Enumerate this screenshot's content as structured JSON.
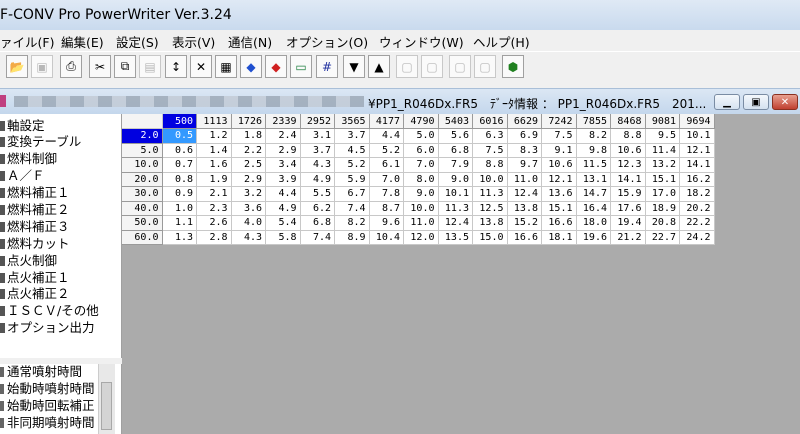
{
  "app": {
    "title": "F-CONV Pro PowerWriter Ver.3.24"
  },
  "menu": [
    "ァイル(F)",
    "編集(E)",
    "設定(S)",
    "表示(V)",
    "通信(N)",
    "オプション(O)",
    "ウィンドウ(W)",
    "ヘルプ(H)"
  ],
  "toolbar": {
    "icons": [
      "open-folder-icon",
      "save-icon",
      "print-icon",
      "cut-icon",
      "copy-icon",
      "paste-icon",
      "font-up-icon",
      "font-clear-icon",
      "stamp-icon",
      "car-blue-icon",
      "car-red-icon",
      "monitor-icon",
      "grid-icon",
      "write-icon",
      "read-icon",
      "disabled-icon-1",
      "disabled-icon-2",
      "disabled-icon-3",
      "disabled-icon-4",
      "shield-icon"
    ]
  },
  "doc": {
    "title": "¥PP1_R046Dx.FR5　ﾃﾞｰﾀ情報 ： PP1_R046Dx.FR5　201..."
  },
  "tree": [
    "軸設定",
    "変換テーブル",
    "燃料制御",
    "Ａ／Ｆ",
    "燃料補正１",
    "燃料補正２",
    "燃料補正３",
    "燃料カット",
    "点火制御",
    "点火補正１",
    "点火補正２",
    "ＩＳＣＶ/その他",
    "オプション出力"
  ],
  "list": [
    "通常噴射時間",
    "始動時噴射時間",
    "始動時回転補正",
    "非同期噴射時間"
  ],
  "table": {
    "cols": [
      "500",
      "1113",
      "1726",
      "2339",
      "2952",
      "3565",
      "4177",
      "4790",
      "5403",
      "6016",
      "6629",
      "7242",
      "7855",
      "8468",
      "9081",
      "9694"
    ],
    "rows": [
      {
        "h": "2.0",
        "v": [
          "0.5",
          "1.2",
          "1.8",
          "2.4",
          "3.1",
          "3.7",
          "4.4",
          "5.0",
          "5.6",
          "6.3",
          "6.9",
          "7.5",
          "8.2",
          "8.8",
          "9.5",
          "10.1"
        ]
      },
      {
        "h": "5.0",
        "v": [
          "0.6",
          "1.4",
          "2.2",
          "2.9",
          "3.7",
          "4.5",
          "5.2",
          "6.0",
          "6.8",
          "7.5",
          "8.3",
          "9.1",
          "9.8",
          "10.6",
          "11.4",
          "12.1"
        ]
      },
      {
        "h": "10.0",
        "v": [
          "0.7",
          "1.6",
          "2.5",
          "3.4",
          "4.3",
          "5.2",
          "6.1",
          "7.0",
          "7.9",
          "8.8",
          "9.7",
          "10.6",
          "11.5",
          "12.3",
          "13.2",
          "14.1"
        ]
      },
      {
        "h": "20.0",
        "v": [
          "0.8",
          "1.9",
          "2.9",
          "3.9",
          "4.9",
          "5.9",
          "7.0",
          "8.0",
          "9.0",
          "10.0",
          "11.0",
          "12.1",
          "13.1",
          "14.1",
          "15.1",
          "16.2"
        ]
      },
      {
        "h": "30.0",
        "v": [
          "0.9",
          "2.1",
          "3.2",
          "4.4",
          "5.5",
          "6.7",
          "7.8",
          "9.0",
          "10.1",
          "11.3",
          "12.4",
          "13.6",
          "14.7",
          "15.9",
          "17.0",
          "18.2"
        ]
      },
      {
        "h": "40.0",
        "v": [
          "1.0",
          "2.3",
          "3.6",
          "4.9",
          "6.2",
          "7.4",
          "8.7",
          "10.0",
          "11.3",
          "12.5",
          "13.8",
          "15.1",
          "16.4",
          "17.6",
          "18.9",
          "20.2"
        ]
      },
      {
        "h": "50.0",
        "v": [
          "1.1",
          "2.6",
          "4.0",
          "5.4",
          "6.8",
          "8.2",
          "9.6",
          "11.0",
          "12.4",
          "13.8",
          "15.2",
          "16.6",
          "18.0",
          "19.4",
          "20.8",
          "22.2"
        ]
      },
      {
        "h": "60.0",
        "v": [
          "1.3",
          "2.8",
          "4.3",
          "5.8",
          "7.4",
          "8.9",
          "10.4",
          "12.0",
          "13.5",
          "15.0",
          "16.6",
          "18.1",
          "19.6",
          "21.2",
          "22.7",
          "24.2"
        ]
      }
    ]
  }
}
